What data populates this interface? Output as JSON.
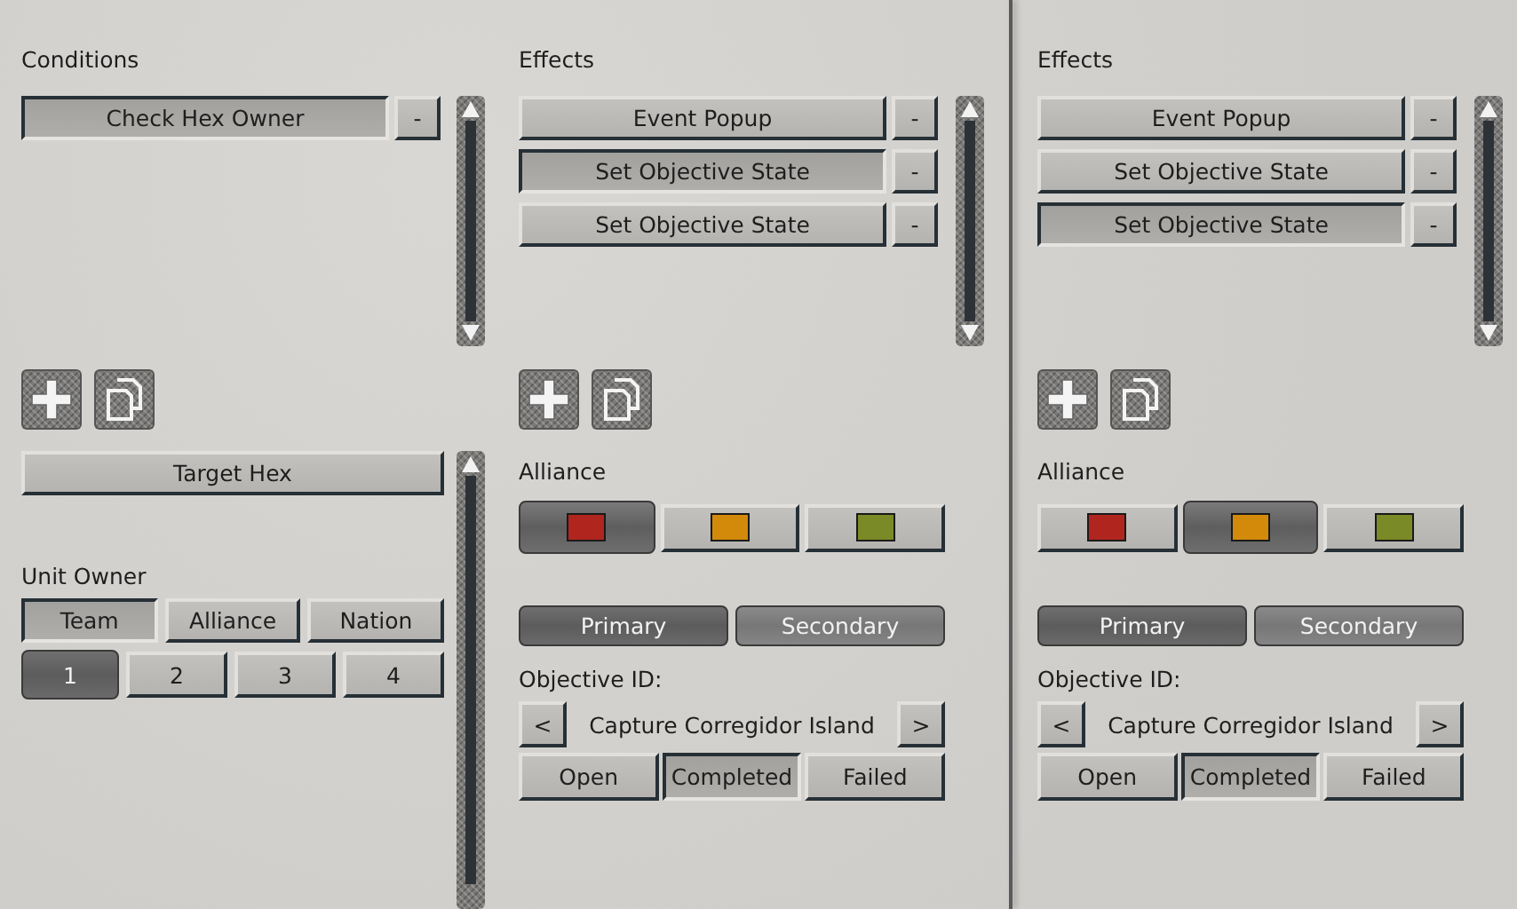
{
  "conditions": {
    "title": "Conditions",
    "items": [
      {
        "label": "Check Hex Owner",
        "selected": true,
        "remove": "-"
      }
    ]
  },
  "condition_editor": {
    "target_button": "Target Hex",
    "unit_owner": {
      "label": "Unit Owner",
      "modes": [
        {
          "label": "Team",
          "selected": true
        },
        {
          "label": "Alliance",
          "selected": false
        },
        {
          "label": "Nation",
          "selected": false
        }
      ],
      "numbers": [
        {
          "label": "1",
          "selected": true
        },
        {
          "label": "2",
          "selected": false
        },
        {
          "label": "3",
          "selected": false
        },
        {
          "label": "4",
          "selected": false
        }
      ]
    }
  },
  "panels": [
    {
      "title": "Effects",
      "items": [
        {
          "label": "Event Popup",
          "selected": false,
          "remove": "-"
        },
        {
          "label": "Set Objective State",
          "selected": true,
          "remove": "-"
        },
        {
          "label": "Set Objective State",
          "selected": false,
          "remove": "-"
        }
      ],
      "alliance": {
        "label": "Alliance",
        "options": [
          {
            "color": "#b0261f",
            "selected": true
          },
          {
            "color": "#d38a0a",
            "selected": false
          },
          {
            "color": "#7a8a26",
            "selected": false
          }
        ]
      },
      "objective_types": [
        {
          "label": "Primary",
          "selected": true
        },
        {
          "label": "Secondary",
          "selected": false
        }
      ],
      "objective_id": {
        "label": "Objective ID:",
        "prev": "<",
        "value": "Capture Corregidor Island",
        "next": ">"
      },
      "states": [
        {
          "label": "Open",
          "selected": false
        },
        {
          "label": "Completed",
          "selected": true
        },
        {
          "label": "Failed",
          "selected": false
        }
      ]
    },
    {
      "title": "Effects",
      "items": [
        {
          "label": "Event Popup",
          "selected": false,
          "remove": "-"
        },
        {
          "label": "Set Objective State",
          "selected": false,
          "remove": "-"
        },
        {
          "label": "Set Objective State",
          "selected": true,
          "remove": "-"
        }
      ],
      "alliance": {
        "label": "Alliance",
        "options": [
          {
            "color": "#b0261f",
            "selected": false
          },
          {
            "color": "#d38a0a",
            "selected": true
          },
          {
            "color": "#7a8a26",
            "selected": false
          }
        ]
      },
      "objective_types": [
        {
          "label": "Primary",
          "selected": true
        },
        {
          "label": "Secondary",
          "selected": false
        }
      ],
      "objective_id": {
        "label": "Objective ID:",
        "prev": "<",
        "value": "Capture Corregidor Island",
        "next": ">"
      },
      "states": [
        {
          "label": "Open",
          "selected": false
        },
        {
          "label": "Completed",
          "selected": true
        },
        {
          "label": "Failed",
          "selected": false
        }
      ]
    }
  ]
}
